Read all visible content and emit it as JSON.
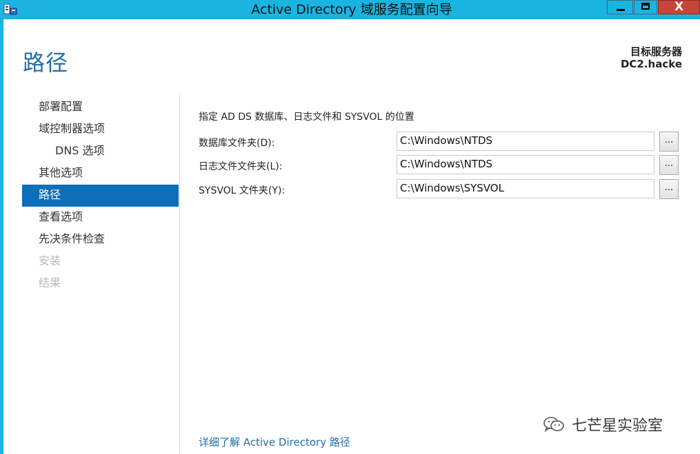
{
  "window": {
    "title": "Active Directory 域服务配置向导",
    "controls": {
      "minimize": "minimize",
      "maximize": "maximize",
      "close": "X"
    }
  },
  "page": {
    "title": "路径",
    "target_server_label": "目标服务器",
    "target_server_name": "DC2.hacke"
  },
  "nav": {
    "items": [
      {
        "label": "部署配置",
        "state": "normal"
      },
      {
        "label": "域控制器选项",
        "state": "normal"
      },
      {
        "label": "DNS 选项",
        "state": "sub"
      },
      {
        "label": "其他选项",
        "state": "normal"
      },
      {
        "label": "路径",
        "state": "active"
      },
      {
        "label": "查看选项",
        "state": "normal"
      },
      {
        "label": "先决条件检查",
        "state": "normal"
      },
      {
        "label": "安装",
        "state": "disabled"
      },
      {
        "label": "结果",
        "state": "disabled"
      }
    ]
  },
  "main": {
    "heading": "指定 AD DS 数据库、日志文件和 SYSVOL 的位置",
    "fields": [
      {
        "label": "数据库文件夹(D):",
        "value": "C:\\Windows\\NTDS",
        "browse": "..."
      },
      {
        "label": "日志文件文件夹(L):",
        "value": "C:\\Windows\\NTDS",
        "browse": "..."
      },
      {
        "label": "SYSVOL 文件夹(Y):",
        "value": "C:\\Windows\\SYSVOL",
        "browse": "..."
      }
    ],
    "help_link": "详细了解 Active Directory 路径"
  },
  "watermark": {
    "text": "七芒星实验室"
  },
  "colors": {
    "titlebar": "#1bb4e0",
    "accent": "#0d6fb8",
    "title_text": "#1f6fa8",
    "close_button": "#c7453a"
  },
  "icons": {
    "app": "server-manager-icon",
    "watermark": "wechat-icon"
  }
}
